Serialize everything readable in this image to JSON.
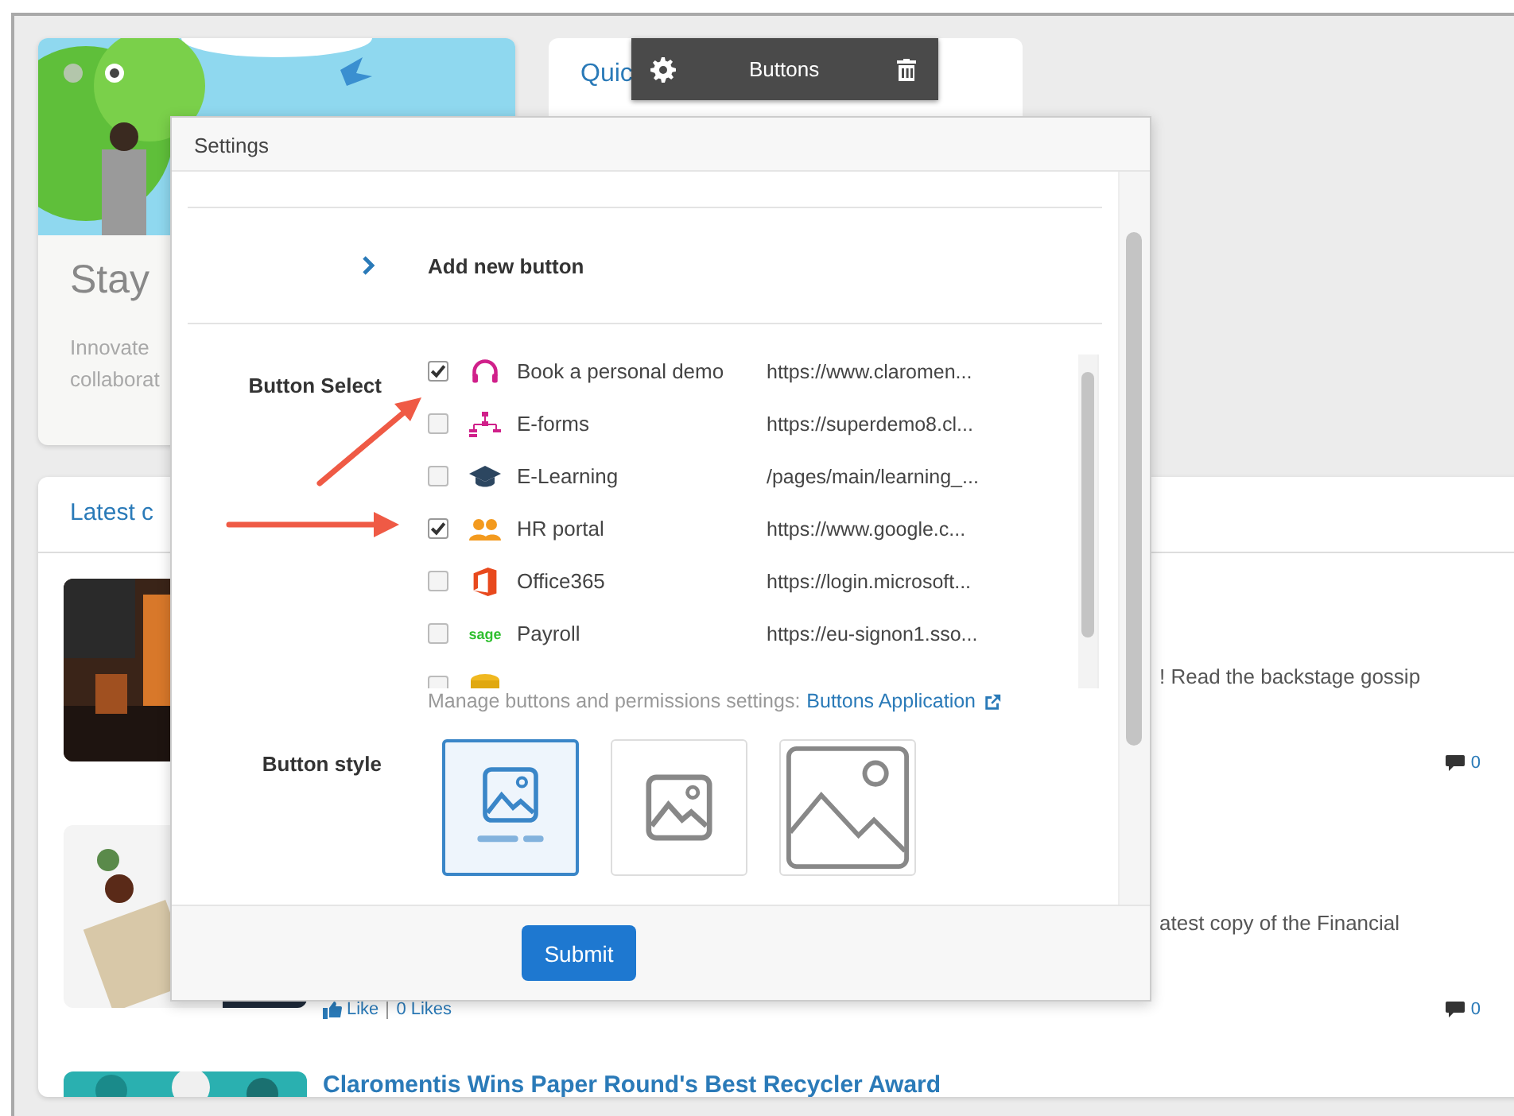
{
  "hero": {
    "slides": [
      {
        "selected": false
      },
      {
        "selected": true
      }
    ],
    "title": "Stay",
    "lines": [
      "Innovate",
      "collaborat"
    ]
  },
  "quick_access": {
    "title": "Quic"
  },
  "toolbar": {
    "label": "Buttons"
  },
  "latest": {
    "title": "Latest c",
    "items": [
      {
        "excerpt": "! Read the backstage gossip",
        "comments": "0"
      },
      {
        "excerpt": "atest copy of the Financial",
        "like": "Like",
        "likes": "0 Likes",
        "comments": "0"
      },
      {
        "title": "Claromentis Wins Paper Round's Best Recycler Award"
      }
    ]
  },
  "dialog": {
    "title": "Settings",
    "add_button": "Add new button",
    "select_label": "Button Select",
    "buttons": [
      {
        "name": "Book a personal demo",
        "url": "https://www.claromen...",
        "checked": true
      },
      {
        "name": "E-forms",
        "url": "https://superdemo8.cl...",
        "checked": false
      },
      {
        "name": "E-Learning",
        "url": "/pages/main/learning_...",
        "checked": false
      },
      {
        "name": "HR portal",
        "url": "https://www.google.c...",
        "checked": true
      },
      {
        "name": "Office365",
        "url": "https://login.microsoft...",
        "checked": false
      },
      {
        "name": "Payroll",
        "url": "https://eu-signon1.sso...",
        "checked": false,
        "logo_text": "sage"
      },
      {
        "checked": false
      }
    ],
    "manage_text": "Manage buttons and permissions settings:",
    "manage_link": "Buttons Application",
    "style_label": "Button style",
    "styles": [
      {
        "kind": "labelled",
        "selected": true
      },
      {
        "kind": "small",
        "selected": false
      },
      {
        "kind": "large",
        "selected": false
      }
    ],
    "submit": "Submit"
  }
}
